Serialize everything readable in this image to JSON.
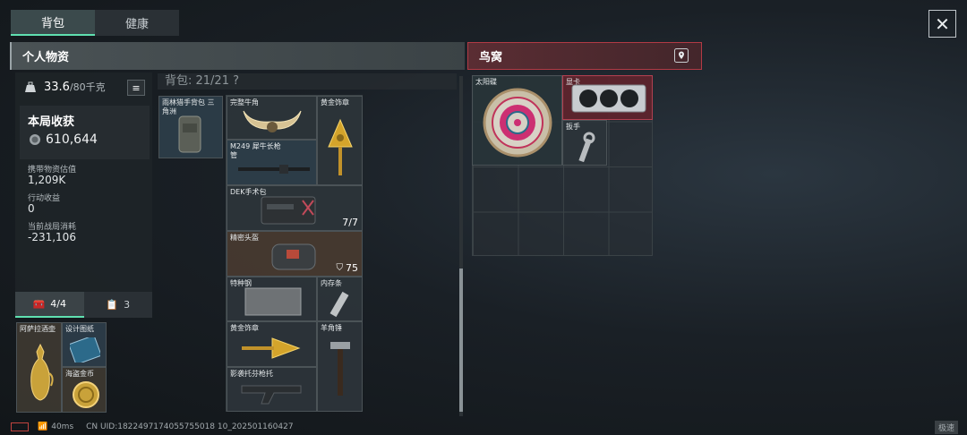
{
  "tabs": [
    {
      "label": "背包"
    },
    {
      "label": "健康"
    }
  ],
  "sections": {
    "personal": "个人物资",
    "nest": "鸟窝"
  },
  "weight": {
    "current": "33.6",
    "max": "/80千克"
  },
  "earnings": {
    "title": "本局收获",
    "coins": "610,644",
    "carry_label": "携带物资估值",
    "carry_value": "1,209K",
    "action_label": "行动收益",
    "action_value": "0",
    "cost_label": "当前战局消耗",
    "cost_value": "-231,106"
  },
  "subtabs": [
    {
      "label": "4/4"
    },
    {
      "label": "3"
    }
  ],
  "backpack_capacity": "背包: 21/21 ?",
  "backpack_slot": {
    "label": "雨林猎手背包 三角洲"
  },
  "items": [
    {
      "name": "完整牛角"
    },
    {
      "name": "黄金饰章"
    },
    {
      "name": "M249 犀牛长枪管"
    },
    {
      "name": "DEK手术包",
      "count": "7/7"
    },
    {
      "name": "精密头盔",
      "durability": "75"
    },
    {
      "name": "特种钢"
    },
    {
      "name": "内存条"
    },
    {
      "name": "黄金饰章"
    },
    {
      "name": "羊角锤"
    },
    {
      "name": "影袭托芬枪托"
    }
  ],
  "pouch_items": [
    {
      "name": "阿萨拉酒壶"
    },
    {
      "name": "设计图纸"
    },
    {
      "name": "海盗金币"
    }
  ],
  "nest_items": [
    {
      "name": "太阳碟"
    },
    {
      "name": "显卡"
    },
    {
      "name": "扳手"
    }
  ],
  "status": {
    "ping": "40ms",
    "uid": "CN UID:1822497174055755018 10_202501160427",
    "mode": "极速"
  },
  "colors": {
    "accent": "#5fe0b0",
    "nest_red": "#b23a45"
  }
}
